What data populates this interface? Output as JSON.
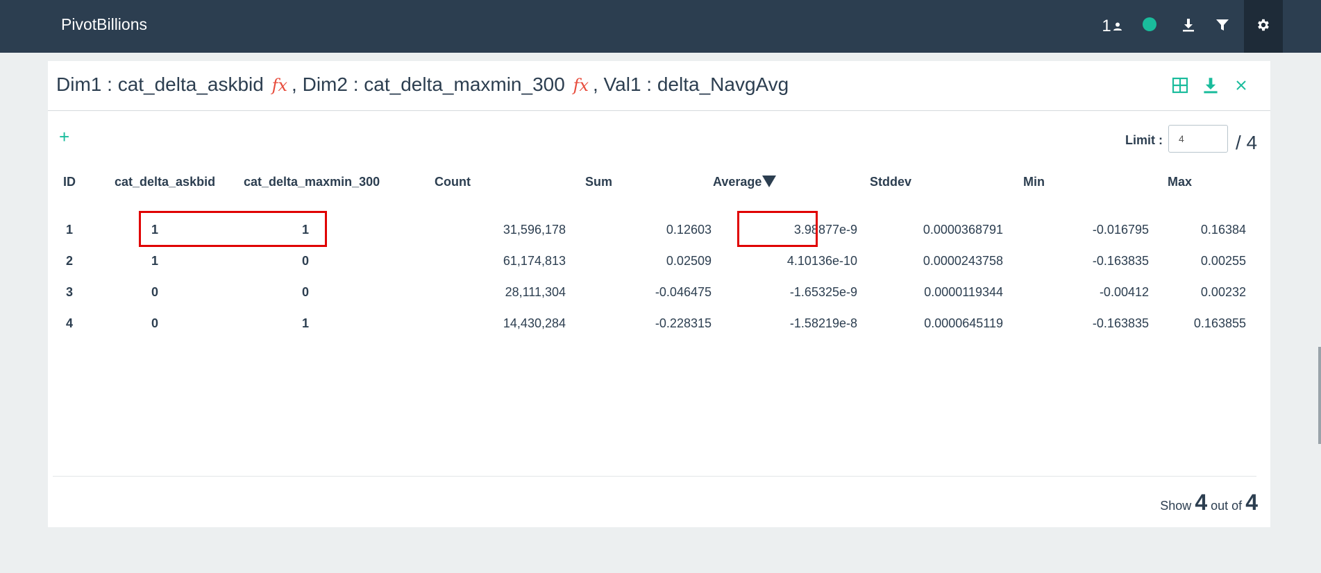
{
  "app": {
    "title": "PivotBillions"
  },
  "topbar": {
    "user_count": "1",
    "status_color": "#1abc9c",
    "icons": [
      "user-icon",
      "status-dot-icon",
      "download-icon",
      "filter-icon",
      "gear-icon"
    ]
  },
  "panel": {
    "title": {
      "dim1_prefix": "Dim1 : ",
      "dim1_value": "cat_delta_askbid",
      "fx": "fx",
      "dim2_prefix": ", Dim2 : ",
      "dim2_value": "cat_delta_maxmin_300",
      "val1_prefix": ", Val1 : ",
      "val1_value": "delta_NavgAvg"
    },
    "header_icons": [
      "grid-icon",
      "download-icon",
      "close-icon"
    ],
    "add_label": "+",
    "limit_label": "Limit :",
    "limit_value": "4",
    "limit_total": "/ 4"
  },
  "table": {
    "columns": [
      "ID",
      "cat_delta_askbid",
      "cat_delta_maxmin_300",
      "Count",
      "Sum",
      "Average",
      "Stddev",
      "Min",
      "Max"
    ],
    "sorted_column": "Average",
    "sort_direction": "descending",
    "rows": [
      [
        "1",
        "1",
        "1",
        "31,596,178",
        "0.12603",
        "3.98877e-9",
        "0.0000368791",
        "-0.016795",
        "0.16384"
      ],
      [
        "2",
        "1",
        "0",
        "61,174,813",
        "0.02509",
        "4.10136e-10",
        "0.0000243758",
        "-0.163835",
        "0.00255"
      ],
      [
        "3",
        "0",
        "0",
        "28,111,304",
        "-0.046475",
        "-1.65325e-9",
        "0.0000119344",
        "-0.00412",
        "0.00232"
      ],
      [
        "4",
        "0",
        "1",
        "14,430,284",
        "-0.228315",
        "-1.58219e-8",
        "0.0000645119",
        "-0.163835",
        "0.163855"
      ]
    ]
  },
  "footer": {
    "show_label": "Show",
    "shown": "4",
    "out_of_label": "out of",
    "total": "4"
  },
  "colors": {
    "topbar": "#2c3e50",
    "accent": "#1abc9c",
    "fx": "#e74c3c",
    "highlight_box": "#e00000"
  }
}
